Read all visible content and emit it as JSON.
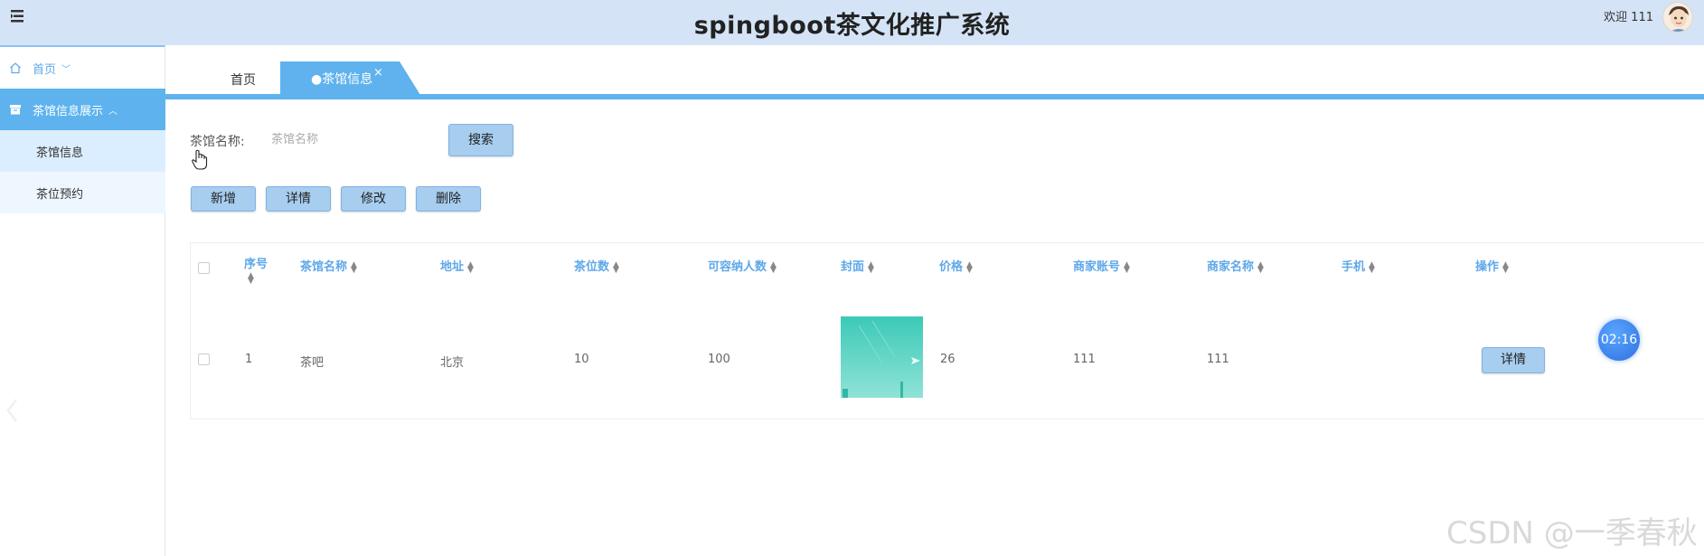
{
  "header": {
    "title": "spingboot茶文化推广系统",
    "welcome": "欢迎 111"
  },
  "sidebar": {
    "home_label": "首页",
    "group_label": "茶馆信息展示",
    "items": [
      {
        "label": "茶馆信息"
      },
      {
        "label": "茶位预约"
      }
    ]
  },
  "tabs": {
    "home_label": "首页",
    "active_label": "●茶馆信息",
    "close_glyph": "×"
  },
  "search": {
    "label": "茶馆名称:",
    "placeholder": "茶馆名称",
    "button_label": "搜索"
  },
  "toolbar": {
    "add_label": "新增",
    "detail_label": "详情",
    "edit_label": "修改",
    "delete_label": "删除"
  },
  "table": {
    "headers": [
      "序号",
      "茶馆名称",
      "地址",
      "茶位数",
      "可容纳人数",
      "封面",
      "价格",
      "商家账号",
      "商家名称",
      "手机",
      "操作"
    ],
    "rows": [
      {
        "index": "1",
        "name": "茶吧",
        "address": "北京",
        "seats": "10",
        "capacity": "100",
        "price": "26",
        "merchant_account": "111",
        "merchant_name": "111",
        "phone": "",
        "action_label": "详情"
      }
    ]
  },
  "timer": "02:16",
  "watermark": "CSDN @一季春秋",
  "colors": {
    "topbar": "#d4e4f6",
    "accent": "#5fb2ee",
    "button": "#a7cdef",
    "header_text": "#5ea8e9"
  }
}
